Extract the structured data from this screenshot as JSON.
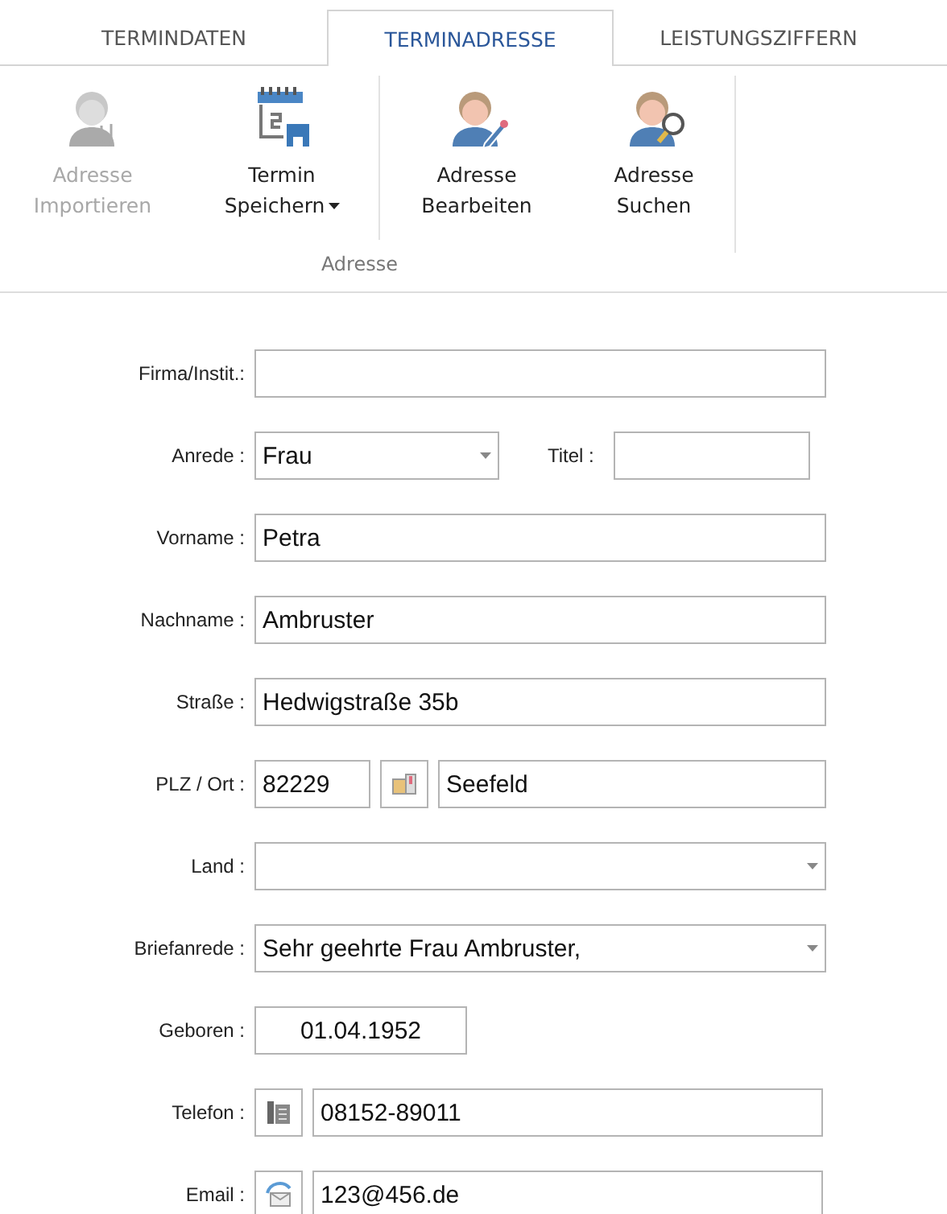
{
  "tabs": [
    {
      "label": "TERMINDATEN",
      "selected": false
    },
    {
      "label": "TERMINADRESSE",
      "selected": true
    },
    {
      "label": "LEISTUNGSZIFFERN",
      "selected": false
    }
  ],
  "ribbon": {
    "group_label": "Adresse",
    "buttons": [
      {
        "kind": "import",
        "lines": [
          "Adresse",
          "Importieren"
        ],
        "disabled": true,
        "dropdown": false
      },
      {
        "kind": "save",
        "lines": [
          "Termin",
          "Speichern"
        ],
        "disabled": false,
        "dropdown": true
      },
      {
        "kind": "edit",
        "lines": [
          "Adresse",
          "Bearbeiten"
        ],
        "disabled": false,
        "dropdown": false
      },
      {
        "kind": "search",
        "lines": [
          "Adresse",
          "Suchen"
        ],
        "disabled": false,
        "dropdown": false
      }
    ]
  },
  "form": {
    "rows": [
      {
        "kind": "text",
        "label": "Firma/Instit.:"
      },
      {
        "kind": "select-title",
        "label": "Anrede :",
        "value": "Frau",
        "title_label": "Titel :"
      },
      {
        "kind": "text",
        "label": "Vorname :",
        "value": "Petra"
      },
      {
        "kind": "text",
        "label": "Nachname :",
        "value": "Ambruster"
      },
      {
        "kind": "text",
        "label": "Straße :",
        "value": "Hedwigstraße 35b"
      },
      {
        "kind": "zip-city",
        "label": "PLZ / Ort :",
        "zip": "82229",
        "city": "Seefeld"
      },
      {
        "kind": "select",
        "label": "Land :"
      },
      {
        "kind": "select",
        "label": "Briefanrede :",
        "value": "Sehr geehrte Frau Ambruster,"
      },
      {
        "kind": "date",
        "label": "Geboren :",
        "value": "01.04.1952"
      },
      {
        "kind": "phone",
        "label": "Telefon :",
        "value": "08152-89011"
      },
      {
        "kind": "email",
        "label": "Email :",
        "value": "123@456.de"
      }
    ]
  }
}
